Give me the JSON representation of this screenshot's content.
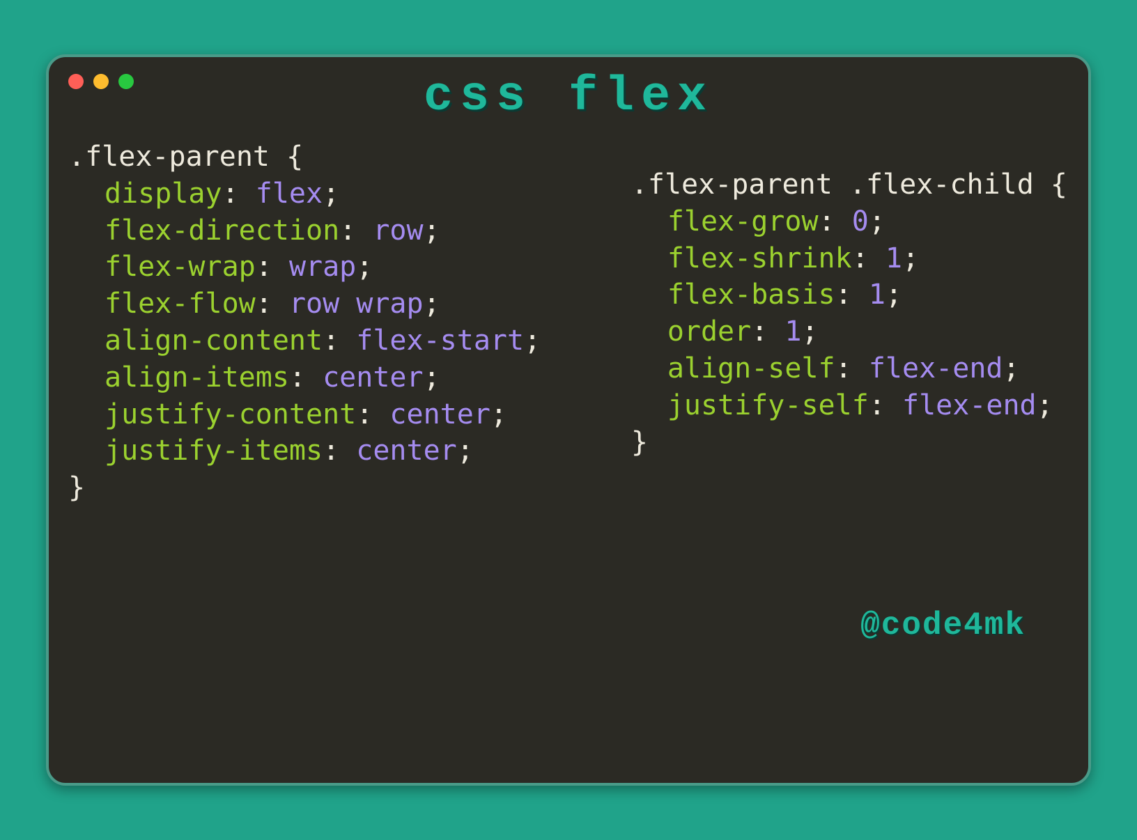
{
  "colors": {
    "close": "#ff5f57",
    "min": "#febc2e",
    "max": "#28c840"
  },
  "title": "css flex",
  "handle": "@code4mk",
  "left": {
    "selector": ".flex-parent",
    "props": [
      {
        "name": "display",
        "value": "flex"
      },
      {
        "name": "flex-direction",
        "value": "row"
      },
      {
        "name": "flex-wrap",
        "value": "wrap"
      },
      {
        "name": "flex-flow",
        "value": "row wrap"
      },
      {
        "name": "align-content",
        "value": "flex-start"
      },
      {
        "name": "align-items",
        "value": "center"
      },
      {
        "name": "justify-content",
        "value": "center"
      },
      {
        "name": "justify-items",
        "value": "center"
      }
    ]
  },
  "right": {
    "selector": ".flex-parent .flex-child",
    "props": [
      {
        "name": "flex-grow",
        "value": "0"
      },
      {
        "name": "flex-shrink",
        "value": "1"
      },
      {
        "name": "flex-basis",
        "value": "1"
      },
      {
        "name": "order",
        "value": "1"
      },
      {
        "name": "align-self",
        "value": "flex-end"
      },
      {
        "name": "justify-self",
        "value": "flex-end"
      }
    ]
  }
}
